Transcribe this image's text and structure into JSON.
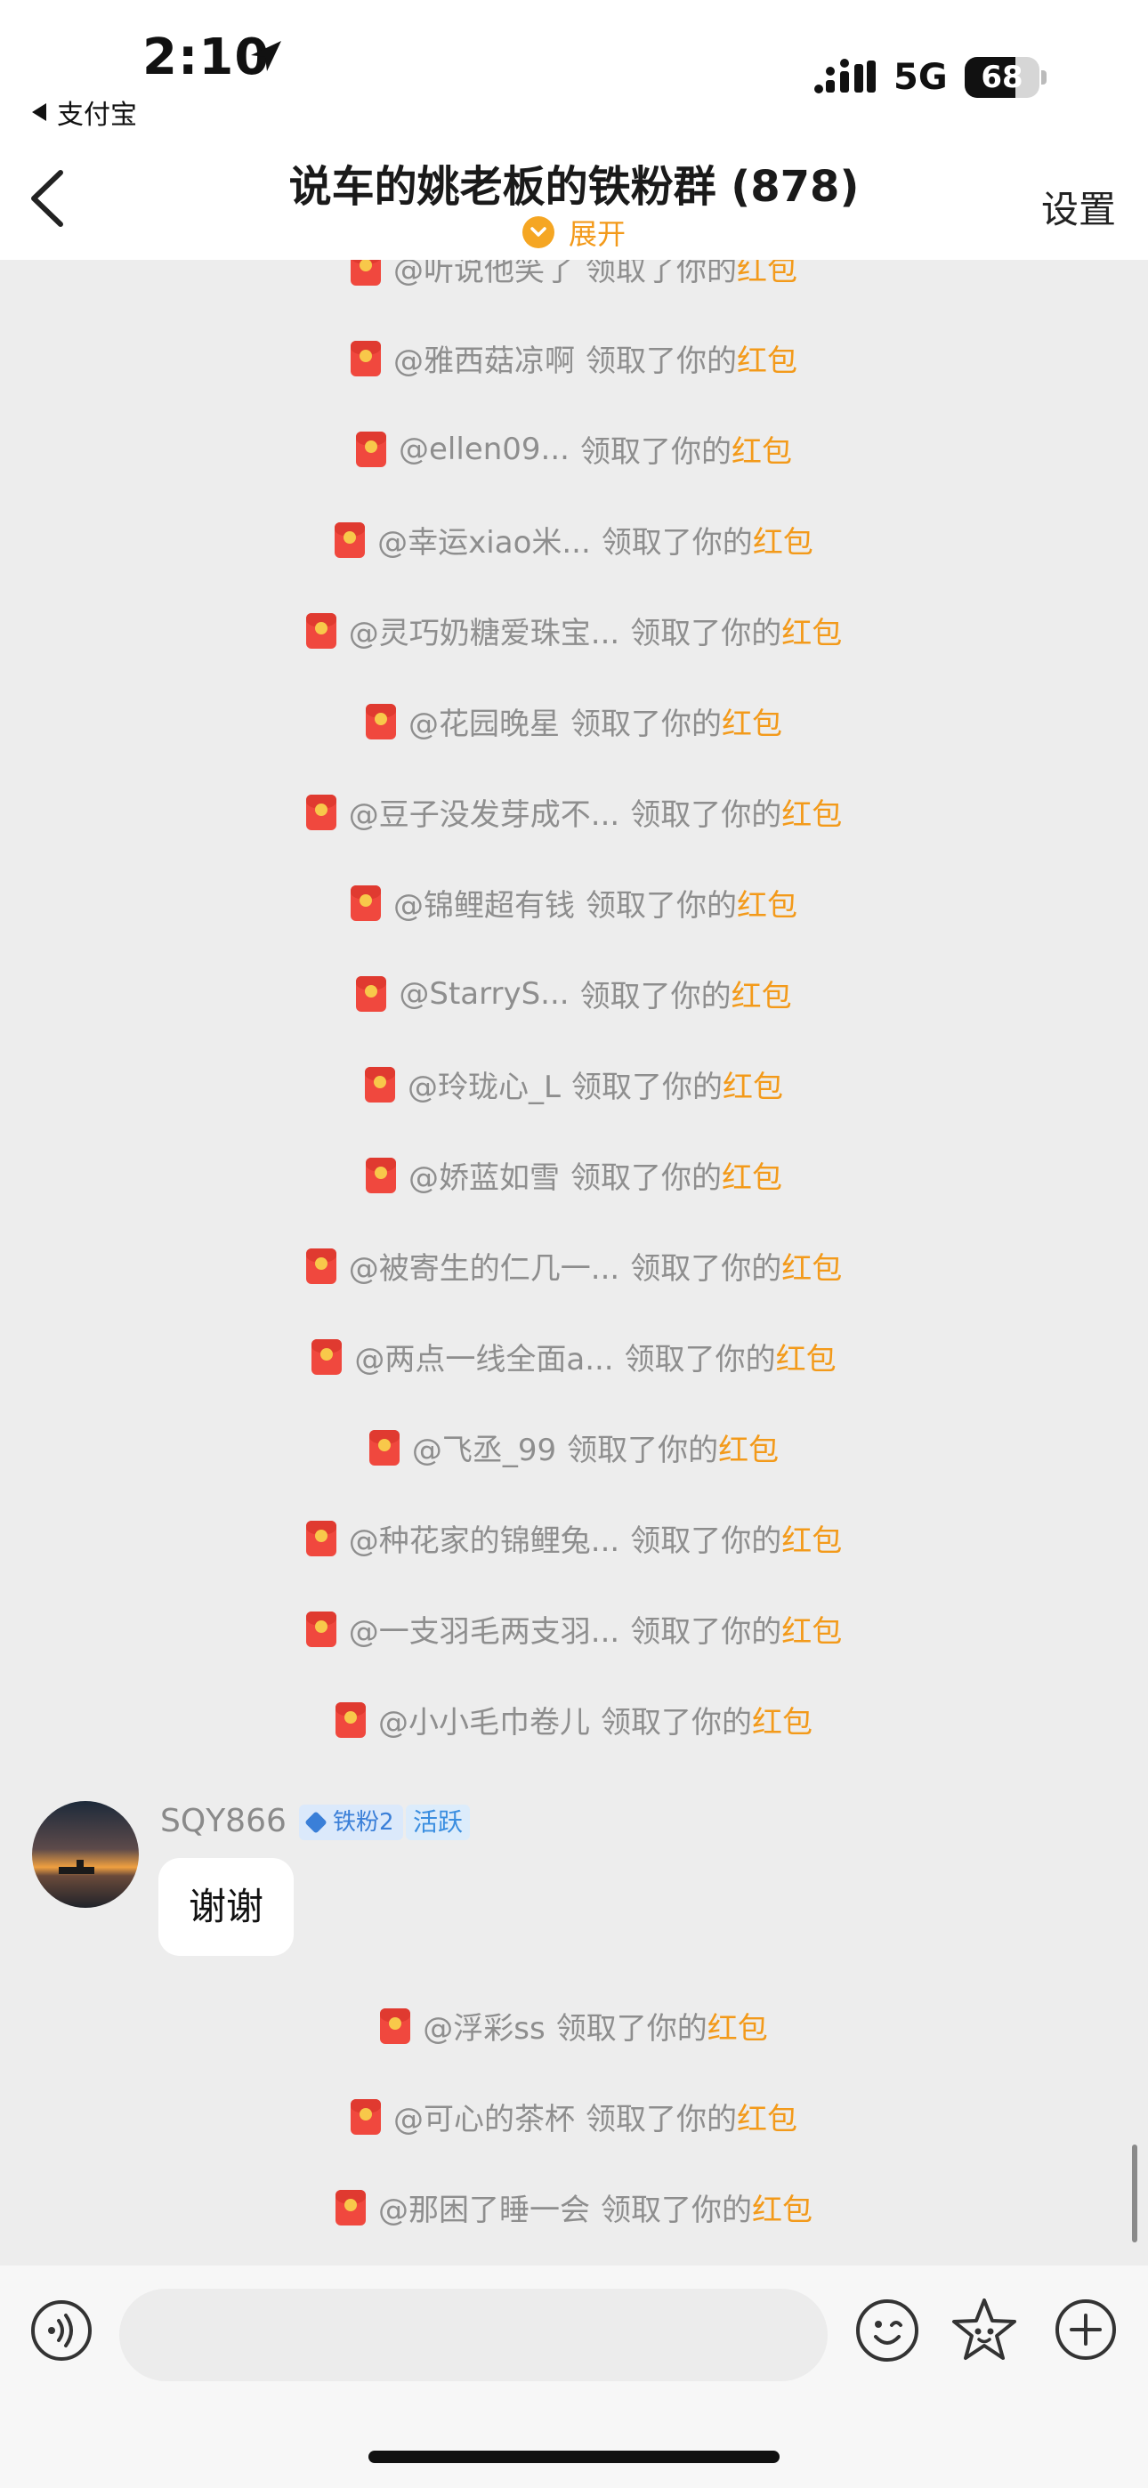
{
  "status_bar": {
    "time": "2:10",
    "back_app": "支付宝",
    "network": "5G",
    "battery": "68",
    "battery_level": 0.68
  },
  "header": {
    "title": "说车的姚老板的铁粉群 (878)",
    "expand_label": "展开",
    "settings_label": "设置"
  },
  "notices_top": [
    {
      "user": "@听说他笑了",
      "text": "领取了你的",
      "link": "红包"
    },
    {
      "user": "@雅西菇凉啊",
      "text": "领取了你的",
      "link": "红包"
    },
    {
      "user": "@ellen09...",
      "text": "领取了你的",
      "link": "红包"
    },
    {
      "user": "@幸运xiao米...",
      "text": "领取了你的",
      "link": "红包"
    },
    {
      "user": "@灵巧奶糖爱珠宝...",
      "text": "领取了你的",
      "link": "红包"
    },
    {
      "user": "@花园晚星",
      "text": "领取了你的",
      "link": "红包"
    },
    {
      "user": "@豆子没发芽成不...",
      "text": "领取了你的",
      "link": "红包"
    },
    {
      "user": "@锦鲤超有钱",
      "text": "领取了你的",
      "link": "红包"
    },
    {
      "user": "@StarryS...",
      "text": "领取了你的",
      "link": "红包"
    },
    {
      "user": "@玲珑心_L",
      "text": "领取了你的",
      "link": "红包"
    },
    {
      "user": "@娇蓝如雪",
      "text": "领取了你的",
      "link": "红包"
    },
    {
      "user": "@被寄生的仁几一...",
      "text": "领取了你的",
      "link": "红包"
    },
    {
      "user": "@两点一线全面a...",
      "text": "领取了你的",
      "link": "红包"
    },
    {
      "user": "@飞丞_99",
      "text": "领取了你的",
      "link": "红包"
    },
    {
      "user": "@种花家的锦鲤兔...",
      "text": "领取了你的",
      "link": "红包"
    },
    {
      "user": "@一支羽毛两支羽...",
      "text": "领取了你的",
      "link": "红包"
    },
    {
      "user": "@小小毛巾卷儿",
      "text": "领取了你的",
      "link": "红包"
    }
  ],
  "message": {
    "sender": "SQY866",
    "badge_fan": "铁粉2",
    "badge_active": "活跃",
    "text": "谢谢"
  },
  "notices_bottom": [
    {
      "user": "@浮彩ss",
      "text": "领取了你的",
      "link": "红包"
    },
    {
      "user": "@可心的茶杯",
      "text": "领取了你的",
      "link": "红包"
    },
    {
      "user": "@那困了睡一会",
      "text": "领取了你的",
      "link": "红包"
    }
  ],
  "input": {
    "placeholder": ""
  },
  "colors": {
    "accent": "#f39a1a",
    "chat_bg": "#ededed",
    "redpacket": "#f0483e"
  },
  "icons": {
    "voice": "voice-wave-icon",
    "emoji": "emoji-icon",
    "sticker": "star-sticker-icon",
    "more": "plus-icon"
  }
}
